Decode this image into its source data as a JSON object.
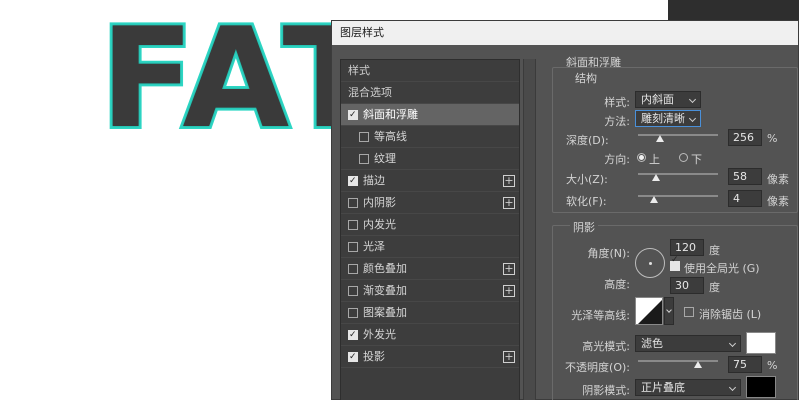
{
  "canvas": {
    "text": "FAT"
  },
  "dialog": {
    "title": "图层样式",
    "left_panel": {
      "header": "样式",
      "blend_options": "混合选项",
      "items": [
        {
          "label": "斜面和浮雕",
          "checked": true,
          "selected": true,
          "plus": false,
          "indent": false
        },
        {
          "label": "等高线",
          "checked": false,
          "plus": false,
          "indent": true
        },
        {
          "label": "纹理",
          "checked": false,
          "plus": false,
          "indent": true
        },
        {
          "label": "描边",
          "checked": true,
          "plus": true,
          "indent": false
        },
        {
          "label": "内阴影",
          "checked": false,
          "plus": true,
          "indent": false
        },
        {
          "label": "内发光",
          "checked": false,
          "plus": false,
          "indent": false
        },
        {
          "label": "光泽",
          "checked": false,
          "plus": false,
          "indent": false
        },
        {
          "label": "颜色叠加",
          "checked": false,
          "plus": true,
          "indent": false
        },
        {
          "label": "渐变叠加",
          "checked": false,
          "plus": true,
          "indent": false
        },
        {
          "label": "图案叠加",
          "checked": false,
          "plus": false,
          "indent": false
        },
        {
          "label": "外发光",
          "checked": true,
          "plus": false,
          "indent": false
        },
        {
          "label": "投影",
          "checked": true,
          "plus": true,
          "indent": false
        }
      ],
      "plus_symbol": "+"
    },
    "bevel": {
      "section_title": "斜面和浮雕",
      "structure_title": "结构",
      "style_label": "样式:",
      "style_value": "内斜面",
      "technique_label": "方法:",
      "technique_value": "雕刻清晰",
      "depth_label": "深度(D):",
      "depth_value": "256",
      "depth_unit": "%",
      "depth_level": 0.27,
      "direction_label": "方向:",
      "direction_up": "上",
      "direction_down": "下",
      "size_label": "大小(Z):",
      "size_value": "58",
      "size_unit": "像素",
      "size_level": 0.22,
      "soften_label": "软化(F):",
      "soften_value": "4",
      "soften_unit": "像素",
      "soften_level": 0.2
    },
    "shading": {
      "title": "阴影",
      "angle_label": "角度(N):",
      "angle_value": "120",
      "angle_unit": "度",
      "global_light_label": "使用全局光 (G)",
      "altitude_label": "高度:",
      "altitude_value": "30",
      "altitude_unit": "度",
      "gloss_contour_label": "光泽等高线:",
      "anti_alias_label": "消除锯齿 (L)",
      "highlight_mode_label": "高光模式:",
      "highlight_mode_value": "滤色",
      "highlight_color": "#ffffff",
      "opacity_label": "不透明度(O):",
      "opacity_value": "75",
      "opacity_unit": "%",
      "opacity_level": 0.75,
      "shadow_mode_label": "阴影模式:",
      "shadow_mode_value": "正片叠底",
      "shadow_color": "#000000"
    }
  }
}
